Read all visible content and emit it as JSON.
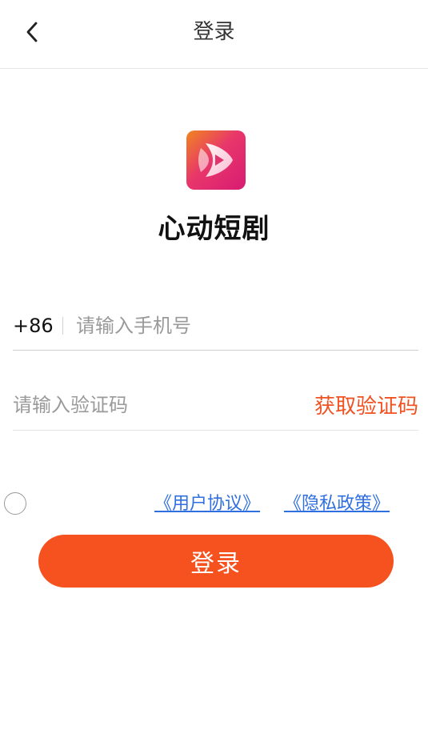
{
  "header": {
    "back_icon": "chevron-left-icon",
    "title": "登录"
  },
  "app": {
    "logo_icon": "play-logo-icon",
    "name": "心动短剧"
  },
  "phone": {
    "country_code": "+86",
    "value": "",
    "placeholder": "请输入手机号"
  },
  "code": {
    "value": "",
    "placeholder": "请输入验证码",
    "get_code_label": "获取验证码"
  },
  "agreement": {
    "checked": false,
    "user_agreement": "《用户协议》",
    "privacy_policy": "《隐私政策》"
  },
  "login_button": {
    "label": "登录"
  },
  "colors": {
    "accent": "#f5521f",
    "link": "#2f6fe0",
    "get_code": "#f05222"
  }
}
